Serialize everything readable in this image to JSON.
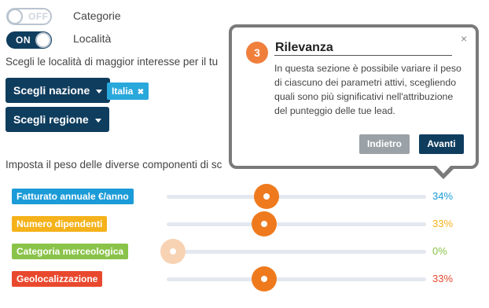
{
  "toggles": {
    "categorie": {
      "state": "OFF",
      "label": "Categorie"
    },
    "localita": {
      "state": "ON",
      "label": "Località"
    }
  },
  "intro_text": "Scegli le località di maggior interesse per il tu",
  "buttons": {
    "nation": "Scegli nazione",
    "region": "Scegli regione"
  },
  "selected_tag": {
    "label": "Italia",
    "remove_icon": "✖"
  },
  "weights_text": "Imposta il peso delle diverse componenti di sc",
  "sliders": [
    {
      "label": "Fatturato annuale €/anno",
      "value": 34,
      "value_text": "34%",
      "color": "#1b9bd7",
      "handle_color": "#ee7a1d"
    },
    {
      "label": "Numero dipendenti",
      "value": 33,
      "value_text": "33%",
      "color": "#f5b21b",
      "handle_color": "#ee7a1d"
    },
    {
      "label": "Categoria merceologica",
      "value": 0,
      "value_text": "0%",
      "color": "#8ac349",
      "handle_color": "#f7d2b3"
    },
    {
      "label": "Geolocalizzazione",
      "value": 33,
      "value_text": "33%",
      "color": "#e8492e",
      "handle_color": "#ee7a1d"
    }
  ],
  "popover": {
    "step": "3",
    "title": "Rilevanza",
    "close_icon": "×",
    "body": "In questa sezione è possibile variare il peso di ciascuno dei parametri attivi, scegliendo quali sono più significativi nell'attribuzione del punteggio delle tue lead.",
    "prev": "Indietro",
    "next": "Avanti"
  }
}
